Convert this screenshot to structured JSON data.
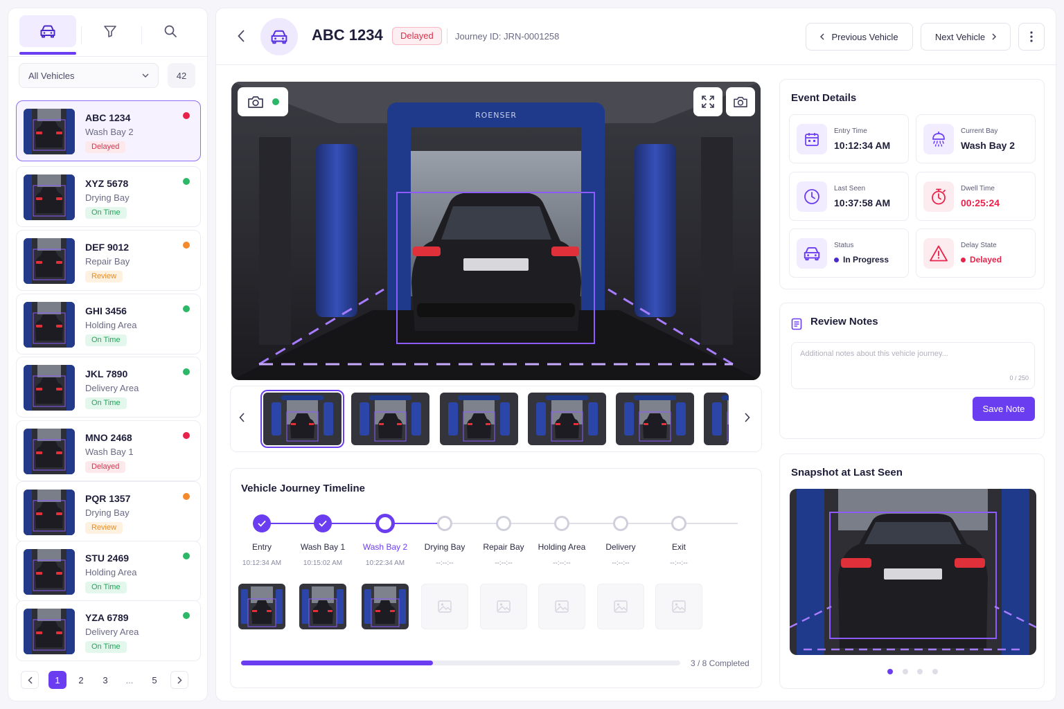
{
  "sidebar": {
    "tabs": [
      {
        "icon": "car-icon"
      },
      {
        "icon": "filter-icon"
      },
      {
        "icon": "search-icon"
      }
    ],
    "filter_label": "All Vehicles",
    "count": "42",
    "vehicles": [
      {
        "plate": "ABC 1234",
        "location": "Wash Bay 2",
        "status": "Delayed",
        "dot": "#e8234b"
      },
      {
        "plate": "XYZ 5678",
        "location": "Drying Bay",
        "status": "On Time",
        "dot": "#2cb868"
      },
      {
        "plate": "DEF 9012",
        "location": "Repair Bay",
        "status": "Review",
        "dot": "#f38b2c"
      },
      {
        "plate": "GHI 3456",
        "location": "Holding Area",
        "status": "On Time",
        "dot": "#2cb868"
      },
      {
        "plate": "JKL 7890",
        "location": "Delivery Area",
        "status": "On Time",
        "dot": "#2cb868"
      },
      {
        "plate": "MNO 2468",
        "location": "Wash Bay 1",
        "status": "Delayed",
        "dot": "#e8234b"
      },
      {
        "plate": "PQR 1357",
        "location": "Drying Bay",
        "status": "Review",
        "dot": "#f38b2c"
      },
      {
        "plate": "STU 2469",
        "location": "Holding Area",
        "status": "On Time",
        "dot": "#2cb868"
      },
      {
        "plate": "YZA 6789",
        "location": "Delivery Area",
        "status": "On Time",
        "dot": "#2cb868"
      }
    ],
    "pager": {
      "pages": [
        "1",
        "2",
        "3",
        "...",
        "5"
      ],
      "current": "1"
    }
  },
  "header": {
    "title": "ABC 1234",
    "badge": "Delayed",
    "journey_id": "Journey ID: JRN-0001258",
    "prev_label": "Previous Vehicle",
    "next_label": "Next Vehicle"
  },
  "camera": {
    "brand": "ROENSER",
    "live_color": "#2cb868"
  },
  "timeline": {
    "title": "Vehicle Journey Timeline",
    "stages": [
      {
        "label": "Entry",
        "time": "10:12:34 AM",
        "state": "done"
      },
      {
        "label": "Wash Bay 1",
        "time": "10:15:02 AM",
        "state": "done"
      },
      {
        "label": "Wash Bay 2",
        "time": "10:22:34 AM",
        "state": "current"
      },
      {
        "label": "Drying Bay",
        "time": "--:--:--",
        "state": "pending"
      },
      {
        "label": "Repair Bay",
        "time": "--:--:--",
        "state": "pending"
      },
      {
        "label": "Holding Area",
        "time": "--:--:--",
        "state": "pending"
      },
      {
        "label": "Delivery",
        "time": "--:--:--",
        "state": "pending"
      },
      {
        "label": "Exit",
        "time": "--:--:--",
        "state": "pending"
      }
    ],
    "progress": 0.4375,
    "progress_text": "3 / 8 Completed"
  },
  "event_details": {
    "title": "Event Details",
    "items": [
      {
        "label": "Entry Time",
        "value": "10:12:34 AM",
        "icon": "calendar-icon"
      },
      {
        "label": "Current Bay",
        "value": "Wash Bay 2",
        "icon": "shower-icon"
      },
      {
        "label": "Last Seen",
        "value": "10:37:58 AM",
        "icon": "clock-icon"
      },
      {
        "label": "Dwell Time",
        "value": "00:25:24",
        "icon": "stopwatch-icon"
      },
      {
        "label": "Status",
        "value": "In Progress",
        "icon": "car-icon"
      },
      {
        "label": "Delay State",
        "value": "Delayed",
        "icon": "warning-icon"
      }
    ]
  },
  "review_notes": {
    "title": "Review Notes",
    "placeholder": "Additional notes about this vehicle journey...",
    "counter": "0 / 250",
    "save_label": "Save Note"
  },
  "snapshot": {
    "title": "Snapshot at Last Seen",
    "dots": 4,
    "active_dot": 0
  },
  "colors": {
    "accent": "#6b3df0",
    "danger": "#d8324a",
    "success": "#26a05a",
    "warning": "#e98b1e"
  }
}
